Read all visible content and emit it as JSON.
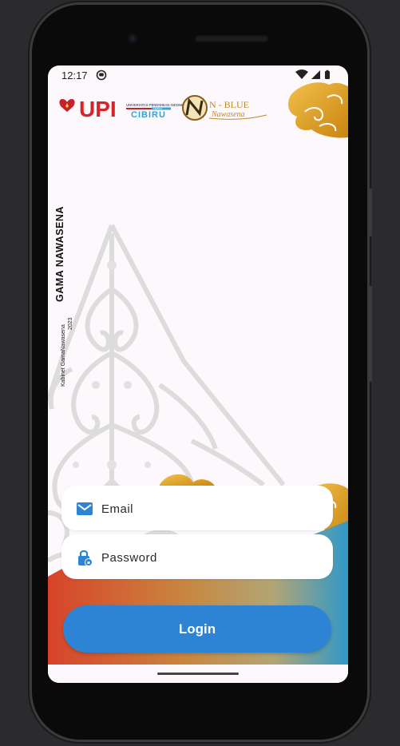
{
  "status_bar": {
    "time": "12:17",
    "icons": [
      "notification-icon",
      "wifi-icon",
      "signal-icon",
      "battery-icon"
    ]
  },
  "header": {
    "logos": [
      "UPI",
      "UNIVERSITAS PENDIDIKAN INDONESIA",
      "KAMPUS",
      "CIBIRU",
      "N - BLUE",
      "Nawasena"
    ]
  },
  "side_text": {
    "title": "GAMA NAWASENA",
    "subtitle": "Kabinet GamaNawasena",
    "year": "2023"
  },
  "form": {
    "email_placeholder": "Email",
    "password_placeholder": "Password",
    "login_label": "Login"
  },
  "colors": {
    "accent": "#2d83d4",
    "gold": "#d99a1a",
    "background": "#fdf8fc"
  }
}
